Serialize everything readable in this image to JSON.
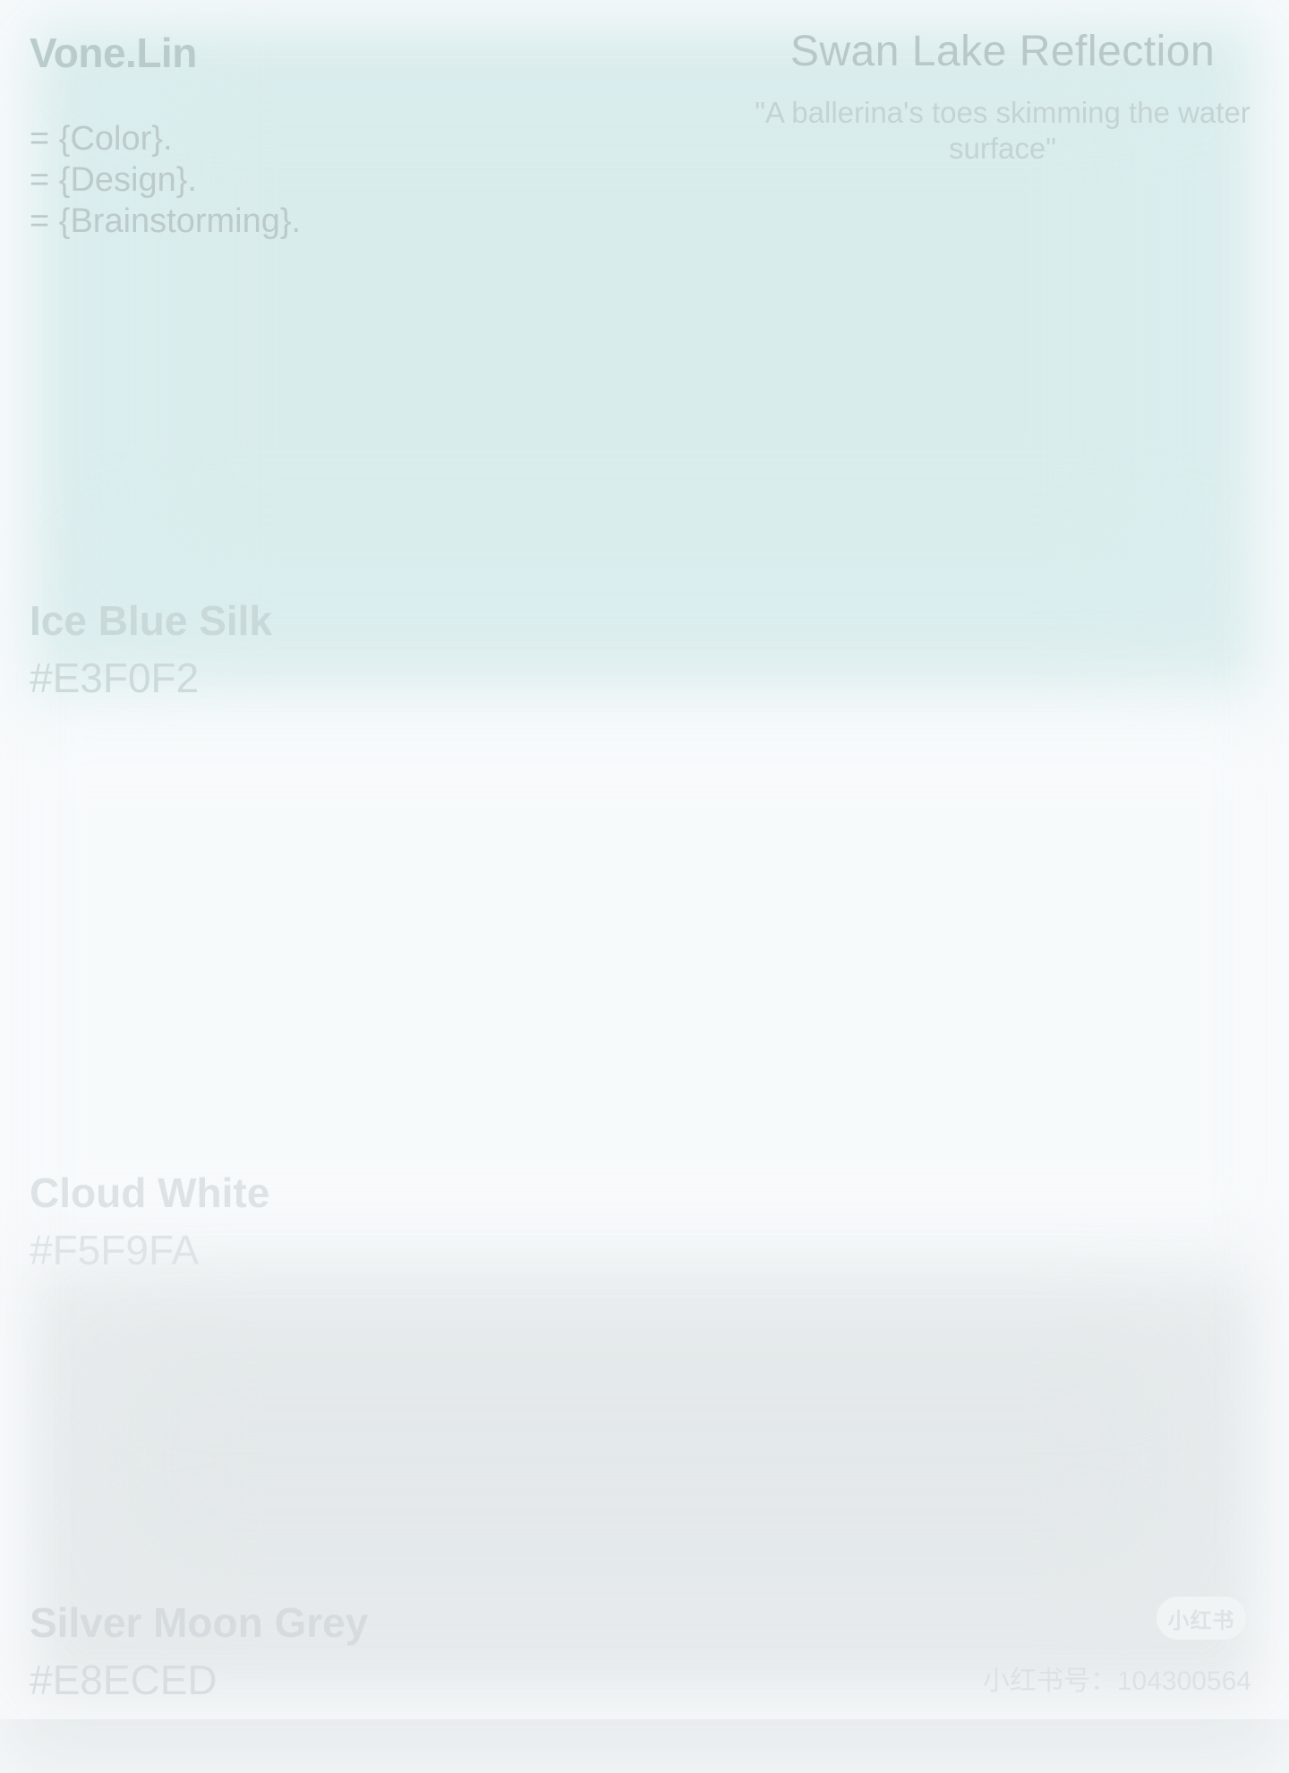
{
  "brand": "Vone.Lin",
  "taglines": [
    "= {Color}.",
    "= {Design}.",
    "= {Brainstorming}."
  ],
  "headline": "Swan Lake Reflection",
  "subhead": "\"A ballerina's toes skimming the water surface\"",
  "swatches": [
    {
      "name": "Ice Blue Silk",
      "hex": "#E3F0F2"
    },
    {
      "name": "Cloud White",
      "hex": "#F5F9FA"
    },
    {
      "name": "Silver Moon Grey",
      "hex": "#E8ECED"
    }
  ],
  "watermark": {
    "logo": "小红书",
    "id_text": "小红书号：104300564"
  }
}
